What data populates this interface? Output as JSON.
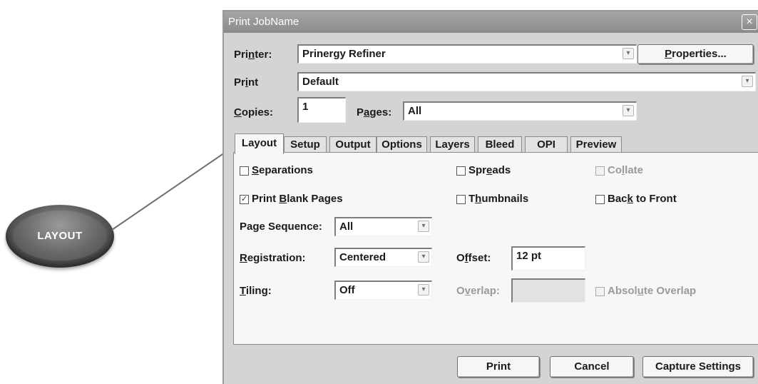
{
  "callout": {
    "label": "LAYOUT"
  },
  "dialog": {
    "title": "Print JobName",
    "close_icon": "×"
  },
  "printer": {
    "label": "Printer:",
    "value": "Prinergy Refiner",
    "properties_button": "Properties..."
  },
  "print": {
    "label": "Print",
    "value": "Default"
  },
  "copies": {
    "label": "Copies:",
    "value": "1"
  },
  "pages": {
    "label": "Pages:",
    "value": "All"
  },
  "tabs": [
    {
      "label": "Layout",
      "active": true
    },
    {
      "label": "Setup"
    },
    {
      "label": "Output"
    },
    {
      "label": "Options"
    },
    {
      "label": "Layers"
    },
    {
      "label": "Bleed"
    },
    {
      "label": "OPI"
    },
    {
      "label": "Preview"
    }
  ],
  "layout": {
    "separations": {
      "label": "Separations",
      "checked": false
    },
    "spreads": {
      "label": "Spreads",
      "checked": false
    },
    "collate": {
      "label": "Collate",
      "checked": false,
      "disabled": true
    },
    "print_blank_pages": {
      "label": "Print Blank Pages",
      "checked": true
    },
    "thumbnails": {
      "label": "Thumbnails",
      "checked": false
    },
    "back_to_front": {
      "label": "Back to Front",
      "checked": false
    },
    "page_sequence": {
      "label": "Page Sequence:",
      "value": "All"
    },
    "registration": {
      "label": "Registration:",
      "value": "Centered"
    },
    "offset": {
      "label": "Offset:",
      "value": "12 pt"
    },
    "tiling": {
      "label": "Tiling:",
      "value": "Off"
    },
    "overlap": {
      "label": "Overlap:",
      "value": ""
    },
    "absolute_overlap": {
      "label": "Absolute Overlap",
      "checked": false,
      "disabled": true
    }
  },
  "buttons": {
    "print": "Print",
    "cancel": "Cancel",
    "capture": "Capture Settings"
  },
  "icons": {
    "dropdown": "chevron-down-icon",
    "check": "✓"
  }
}
